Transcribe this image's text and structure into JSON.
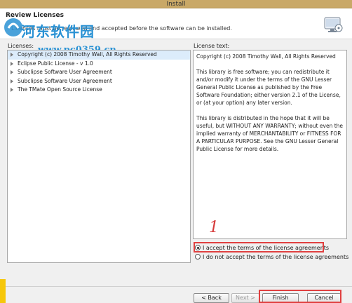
{
  "window": {
    "title": "Install"
  },
  "header": {
    "title": "Review Licenses",
    "description": "Licenses must be reviewed and accepted before the software can be installed."
  },
  "watermark": {
    "brand": "河东软件园",
    "site": "www.pc0359.cn"
  },
  "licenses_label": "Licenses:",
  "license_text_label": "License text:",
  "licenses": [
    "Copyright (c) 2008 Timothy Wall, All Rights Reserved",
    "Eclipse Public License - v 1.0",
    "Subclipse Software User Agreement",
    "Subclipse Software User Agreement",
    "The TMate Open Source License"
  ],
  "license_text": {
    "p1": "Copyright (c) 2008 Timothy Wall, All Rights Reserved",
    "p2": "This library is free software; you can redistribute it and/or modify it under the terms of the GNU Lesser General Public License as published by the Free Software Foundation; either version 2.1 of the License, or (at your option) any later version.",
    "p3": "This library is distributed in the hope that it will be useful, but WITHOUT ANY WARRANTY; without even the implied warranty of MERCHANTABILITY or FITNESS FOR A PARTICULAR PURPOSE.  See the GNU Lesser General Public License for more details."
  },
  "radios": {
    "accept": "I accept the terms of the license agreements",
    "decline": "I do not accept the terms of the license agreements",
    "selected": "accept"
  },
  "annotation": "1",
  "buttons": {
    "back": "< Back",
    "next": "Next >",
    "finish": "Finish",
    "cancel": "Cancel"
  },
  "colors": {
    "highlight": "#e04040",
    "watermark": "#2a92d4",
    "selection": "#dcecfb"
  }
}
